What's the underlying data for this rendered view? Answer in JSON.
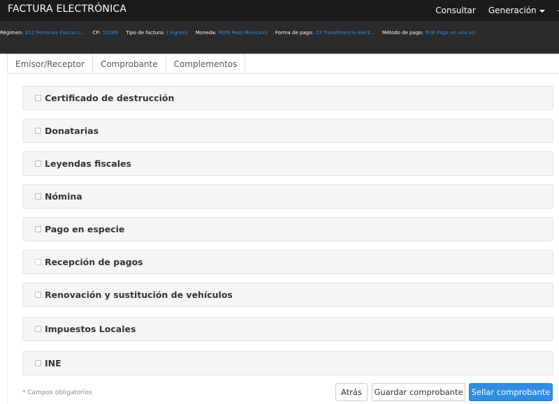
{
  "app": {
    "title": "FACTURA ELECTRÓNICA"
  },
  "nav": {
    "consultar": "Consultar",
    "generacion": "Generación",
    "edge": "-"
  },
  "info": [
    {
      "label": "Régimen:",
      "value": "612 Personas Físicas c..."
    },
    {
      "label": "CP:",
      "value": "55269"
    },
    {
      "label": "Tipo de factura:",
      "value": "I Ingreso"
    },
    {
      "label": "Moneda:",
      "value": "MXN Peso Mexicano"
    },
    {
      "label": "Forma de pago:",
      "value": "03 Transferencia elect..."
    },
    {
      "label": "Método de pago:",
      "value": "PUE Pago en una sol"
    }
  ],
  "tabs": [
    {
      "label": "Emisor/Receptor",
      "active": false
    },
    {
      "label": "Comprobante",
      "active": false
    },
    {
      "label": "Complementos",
      "active": true
    }
  ],
  "complements": [
    {
      "label": "Certificado de destrucción",
      "disabled": false
    },
    {
      "label": "Donatarias",
      "disabled": false
    },
    {
      "label": "Leyendas fiscales",
      "disabled": false
    },
    {
      "label": "Nómina",
      "disabled": false
    },
    {
      "label": "Pago en especie",
      "disabled": false
    },
    {
      "label": "Recepción de pagos",
      "disabled": true
    },
    {
      "label": "Renovación y sustitución de vehículos",
      "disabled": false
    },
    {
      "label": "Impuestos Locales",
      "disabled": false
    },
    {
      "label": "INE",
      "disabled": false
    }
  ],
  "footer": {
    "required_note": "* Campos obligatorios",
    "back_label": "Atrás",
    "save_label": "Guardar comprobante",
    "stamp_label": "Sellar comprobante"
  },
  "colors": {
    "navbar": "#1b1b1b",
    "infobar": "#2b2b2b",
    "info_value": "#3d8fe0",
    "primary": "#2f8de4"
  }
}
